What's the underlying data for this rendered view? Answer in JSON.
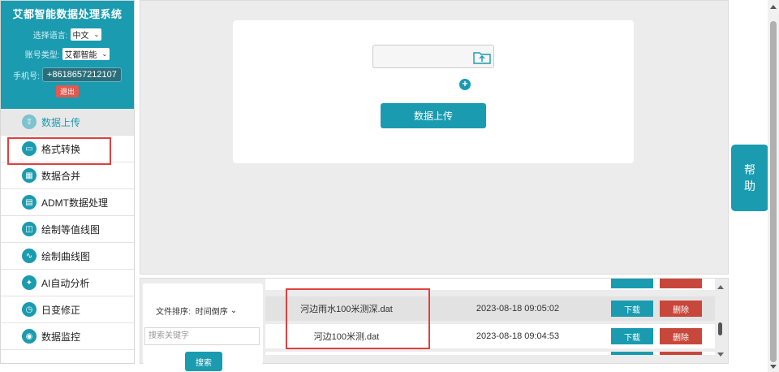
{
  "app": {
    "title": "艾都智能数据处理系统"
  },
  "settings": {
    "language_label": "选择语言:",
    "language_value": "中文",
    "account_label": "账号类型:",
    "account_value": "艾都智能",
    "phone_label": "手机号:",
    "phone_value": "+8618657212107",
    "logout_label": "退出"
  },
  "nav": [
    {
      "label": "数据上传",
      "icon": "upload-icon"
    },
    {
      "label": "格式转换",
      "icon": "convert-icon"
    },
    {
      "label": "数据合并",
      "icon": "merge-icon"
    },
    {
      "label": "ADMT数据处理",
      "icon": "admt-icon"
    },
    {
      "label": "绘制等值线图",
      "icon": "contour-icon"
    },
    {
      "label": "绘制曲线图",
      "icon": "curve-icon"
    },
    {
      "label": "AI自动分析",
      "icon": "ai-icon"
    },
    {
      "label": "日变修正",
      "icon": "clock-icon"
    },
    {
      "label": "数据监控",
      "icon": "monitor-icon"
    }
  ],
  "upload": {
    "button_label": "数据上传",
    "add_symbol": "+"
  },
  "help": {
    "line1": "帮",
    "line2": "助"
  },
  "files": {
    "sort_label": "文件排序:",
    "sort_value": "时间倒序",
    "search_placeholder": "搜索关键字",
    "search_button": "搜索",
    "download_label": "下载",
    "delete_label": "删除",
    "rows": [
      {
        "name": "河边雨水100米测深.dat",
        "time": "2023-08-18 09:05:02"
      },
      {
        "name": "河边100米测.dat",
        "time": "2023-08-18 09:04:53"
      }
    ]
  },
  "colors": {
    "accent": "#1a9bb0",
    "danger": "#c8473b",
    "highlight": "#e04040"
  }
}
